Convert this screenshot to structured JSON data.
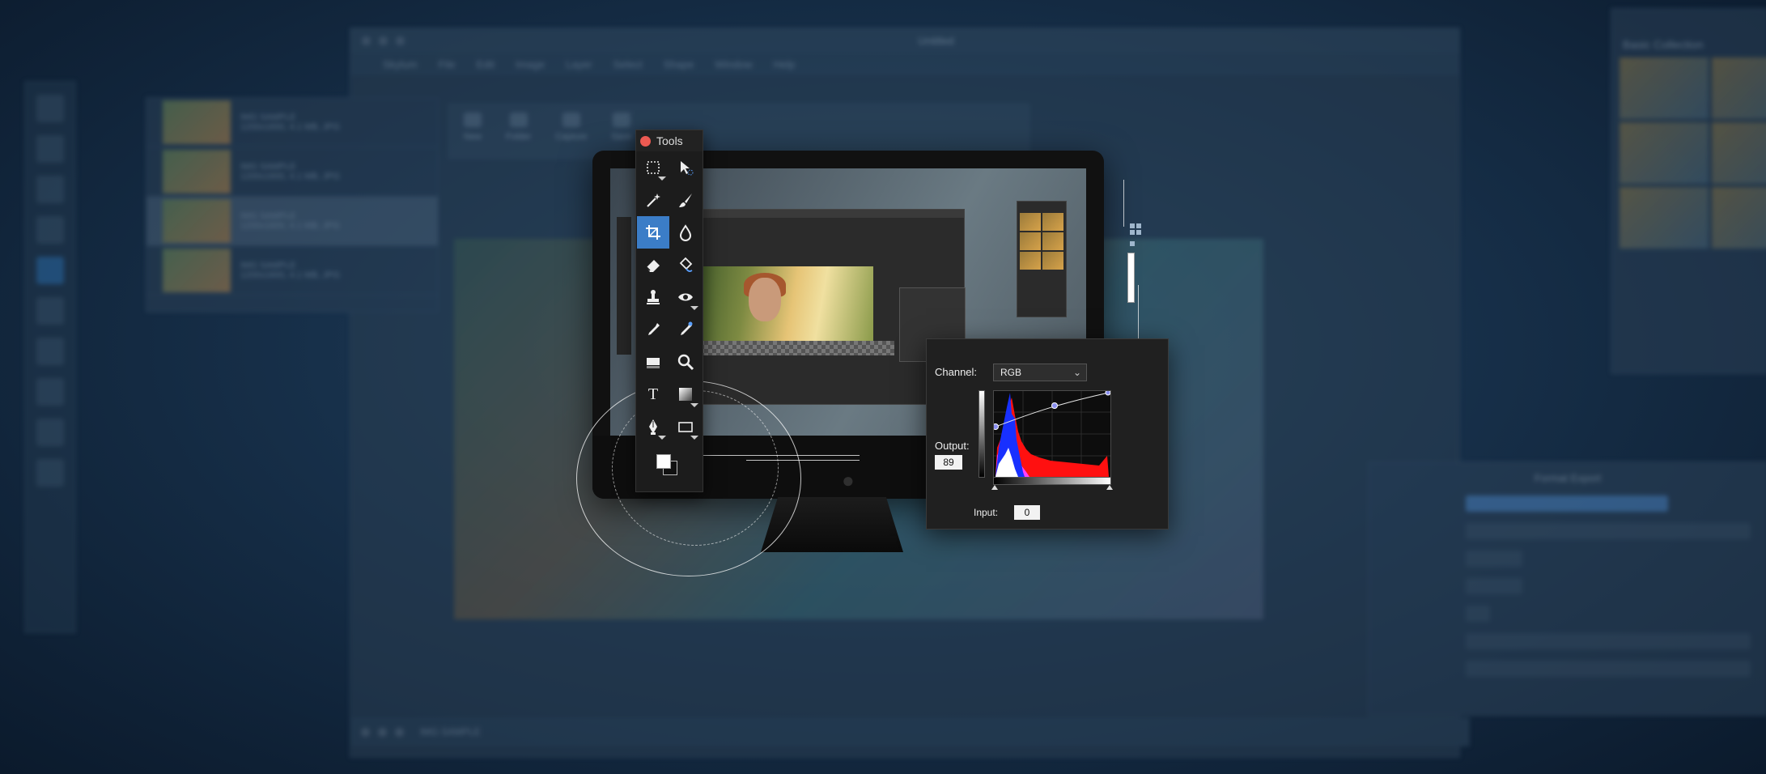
{
  "background_app": {
    "window_title": "Untitled",
    "menu": [
      "Skylum",
      "File",
      "Edit",
      "Image",
      "Layer",
      "Select",
      "Shape",
      "Window",
      "Help"
    ],
    "toolbar": [
      "New",
      "Folder",
      "Capture",
      "Save"
    ],
    "files": [
      {
        "name": "IMG SAMPLE",
        "meta": "1200x1600, 4.1 MB, JPG"
      },
      {
        "name": "IMG SAMPLE",
        "meta": "1200x1600, 4.1 MB, JPG"
      },
      {
        "name": "IMG SAMPLE",
        "meta": "1200x1600, 4.1 MB, JPG"
      },
      {
        "name": "IMG SAMPLE",
        "meta": "1200x1600, 4.1 MB, JPG"
      }
    ],
    "right_panel_title": "Basic Collection",
    "export_title": "Format Export",
    "bottom_tab": "IMG SAMPLE"
  },
  "tools": {
    "title": "Tools",
    "items": [
      {
        "icon": "marquee-icon",
        "active": false,
        "corner": true
      },
      {
        "icon": "move-select-icon",
        "active": false,
        "corner": false
      },
      {
        "icon": "magic-wand-icon",
        "active": false,
        "corner": false
      },
      {
        "icon": "brush-icon",
        "active": false,
        "corner": false
      },
      {
        "icon": "crop-icon",
        "active": true,
        "corner": false
      },
      {
        "icon": "blur-drop-icon",
        "active": false,
        "corner": false
      },
      {
        "icon": "eraser-icon",
        "active": false,
        "corner": false
      },
      {
        "icon": "bucket-icon",
        "active": false,
        "corner": false
      },
      {
        "icon": "stamp-icon",
        "active": false,
        "corner": false
      },
      {
        "icon": "eye-icon",
        "active": false,
        "corner": true
      },
      {
        "icon": "eyedropper-icon",
        "active": false,
        "corner": false
      },
      {
        "icon": "color-picker-icon",
        "active": false,
        "corner": false
      },
      {
        "icon": "text-layer-icon",
        "active": false,
        "corner": false
      },
      {
        "icon": "zoom-icon",
        "active": false,
        "corner": false
      },
      {
        "icon": "type-icon",
        "active": false,
        "corner": false,
        "text": "T"
      },
      {
        "icon": "gradient-icon",
        "active": false,
        "corner": true
      },
      {
        "icon": "pen-icon",
        "active": false,
        "corner": true
      },
      {
        "icon": "rectangle-icon",
        "active": false,
        "corner": true
      }
    ]
  },
  "curves": {
    "channel_label": "Channel:",
    "channel_value": "RGB",
    "output_label": "Output:",
    "output_value": "89",
    "input_label": "Input:",
    "input_value": "0"
  },
  "colors": {
    "accent": "#3b7dc7",
    "close": "#ed5a52"
  }
}
